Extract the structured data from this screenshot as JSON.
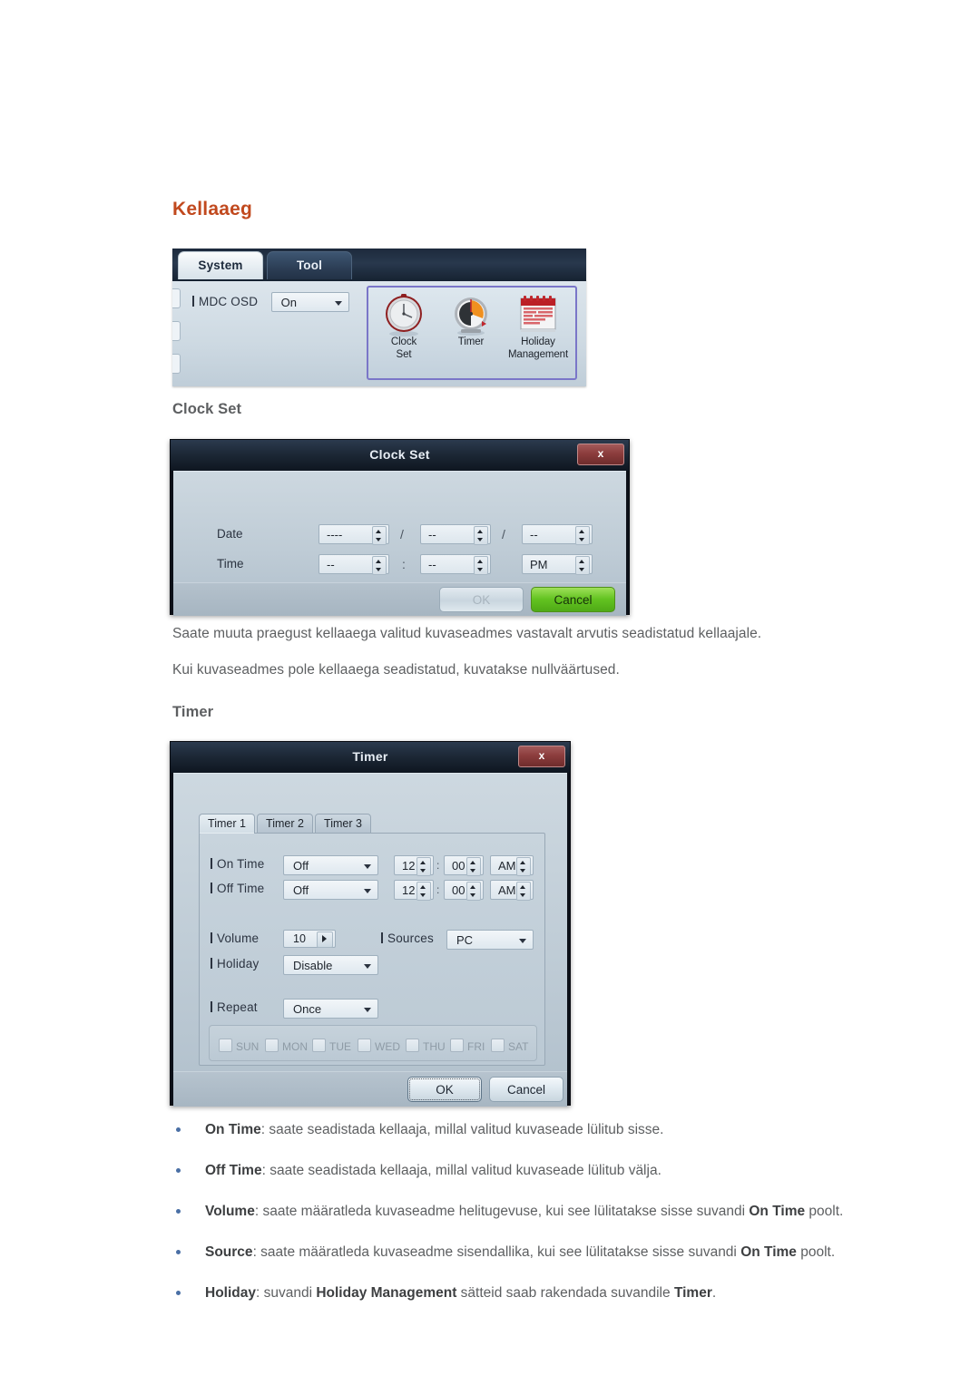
{
  "page": {
    "heading": "Kellaaeg",
    "section_clock_set": "Clock Set",
    "section_timer": "Timer",
    "paragraphs": [
      "Saate muuta praegust kellaaega valitud kuvaseadmes vastavalt arvutis seadistatud kellaajale.",
      "Kui kuvaseadmes pole kellaaega seadistatud, kuvatakse nullväärtused."
    ],
    "accent_color": "#c1491e",
    "bullet_color": "#4a6fa5",
    "body_text_color": "#5d5f61"
  },
  "system_panel": {
    "tabs": [
      {
        "label": "System",
        "selected": true
      },
      {
        "label": "Tool",
        "selected": false
      }
    ],
    "setting": {
      "label": "MDC OSD",
      "value": "On"
    },
    "icons": [
      {
        "name": "clock-set-icon",
        "caption_line1": "Clock",
        "caption_line2": "Set"
      },
      {
        "name": "timer-icon",
        "caption_line1": "Timer",
        "caption_line2": ""
      },
      {
        "name": "holiday-management-icon",
        "caption_line1": "Holiday",
        "caption_line2": "Management"
      }
    ],
    "icon_group_border_color": "#7a76c8"
  },
  "clock_set_dialog": {
    "title": "Clock Set",
    "close_label": "x",
    "rows": [
      {
        "label": "Date",
        "fields": [
          "----",
          "--",
          "--"
        ],
        "separators": [
          "/",
          "/"
        ]
      },
      {
        "label": "Time",
        "fields": [
          "--",
          "--",
          "PM"
        ],
        "separators": [
          ":",
          ""
        ]
      }
    ],
    "buttons": {
      "ok": "OK",
      "ok_disabled": true,
      "cancel": "Cancel",
      "cancel_color": "#63c321"
    }
  },
  "timer_dialog": {
    "title": "Timer",
    "close_label": "x",
    "tabs": [
      {
        "label": "Timer 1",
        "selected": true
      },
      {
        "label": "Timer 2",
        "selected": false
      },
      {
        "label": "Timer 3",
        "selected": false
      }
    ],
    "on_time": {
      "label": "On Time",
      "state": "Off",
      "hour": "12",
      "minute": "00",
      "meridiem": "AM",
      "time_separator": ":"
    },
    "off_time": {
      "label": "Off Time",
      "state": "Off",
      "hour": "12",
      "minute": "00",
      "meridiem": "AM",
      "time_separator": ":"
    },
    "volume": {
      "label": "Volume",
      "value": "10"
    },
    "sources": {
      "label": "Sources",
      "value": "PC"
    },
    "holiday": {
      "label": "Holiday",
      "value": "Disable"
    },
    "repeat": {
      "label": "Repeat",
      "value": "Once"
    },
    "days": [
      {
        "label": "SUN",
        "checked": false
      },
      {
        "label": "MON",
        "checked": false
      },
      {
        "label": "TUE",
        "checked": false
      },
      {
        "label": "WED",
        "checked": false
      },
      {
        "label": "THU",
        "checked": false
      },
      {
        "label": "FRI",
        "checked": false
      },
      {
        "label": "SAT",
        "checked": false
      }
    ],
    "buttons": {
      "ok": "OK",
      "cancel": "Cancel"
    }
  },
  "bullets": [
    {
      "term": "On Time",
      "rest_1": ": saate seadistada kellaaja, millal valitud kuvaseade lülitub sisse.",
      "term_2": "",
      "rest_2": "",
      "term_3": "",
      "rest_3": ""
    },
    {
      "term": "Off Time",
      "rest_1": ": saate seadistada kellaaja, millal valitud kuvaseade lülitub välja.",
      "term_2": "",
      "rest_2": "",
      "term_3": "",
      "rest_3": ""
    },
    {
      "term": "Volume",
      "rest_1": ": saate määratleda kuvaseadme helitugevuse, kui see lülitatakse sisse suvandi ",
      "term_2": "On Time",
      "rest_2": " poolt.",
      "term_3": "",
      "rest_3": ""
    },
    {
      "term": "Source",
      "rest_1": ": saate määratleda kuvaseadme sisendallika, kui see lülitatakse sisse suvandi ",
      "term_2": "On Time",
      "rest_2": " poolt.",
      "term_3": "",
      "rest_3": ""
    },
    {
      "term": "Holiday",
      "rest_1": ": suvandi ",
      "term_2": "Holiday Management",
      "rest_2": " sätteid saab rakendada suvandile ",
      "term_3": "Timer",
      "rest_3": "."
    }
  ]
}
